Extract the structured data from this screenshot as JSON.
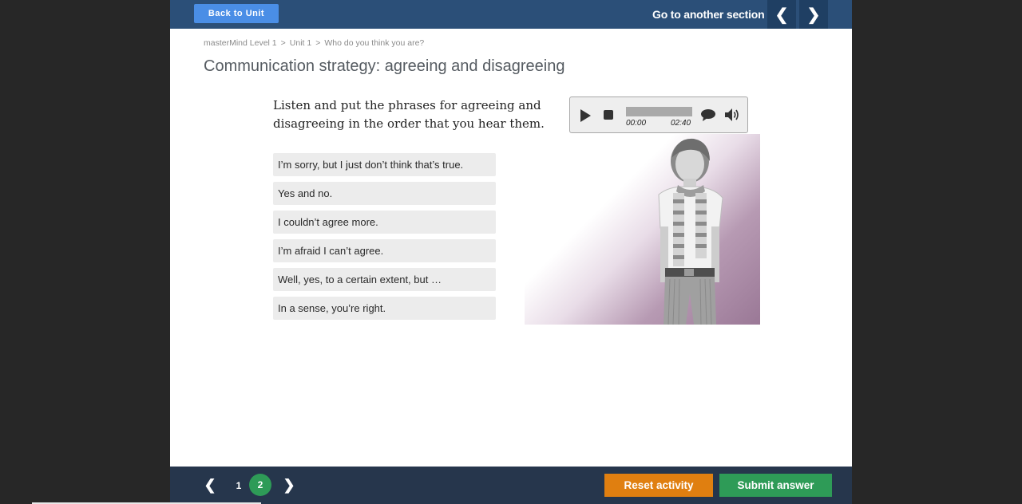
{
  "header": {
    "back_label": "Back to Unit",
    "goto_label": "Go to another section",
    "prev_icon": "chevron-left-icon",
    "next_icon": "chevron-right-icon"
  },
  "breadcrumb": {
    "items": [
      "masterMind Level 1",
      "Unit 1",
      "Who do you think you are?"
    ],
    "separator": ">"
  },
  "page_title": "Communication strategy: agreeing and disagreeing",
  "instructions": "Listen and put the phrases for agreeing and disagreeing in the order that you hear them.",
  "phrases": [
    "I’m sorry, but I just don’t think that’s true.",
    "Yes and no.",
    "I couldn’t agree more.",
    "I’m afraid I can’t agree.",
    "Well, yes, to a certain extent, but …",
    "In a sense, you’re right."
  ],
  "audio": {
    "current_time": "00:00",
    "total_time": "02:40",
    "progress": 0
  },
  "pagination": {
    "pages": [
      "1",
      "2"
    ],
    "current_page": "2"
  },
  "footer": {
    "reset_label": "Reset activity",
    "submit_label": "Submit answer"
  },
  "colors": {
    "header_bg": "#2b4f78",
    "back_button": "#4a8ee6",
    "footer_bg": "#26364c",
    "reset_button": "#e07f10",
    "submit_button": "#2e9b57",
    "active_page": "#2e9b57",
    "illustration_tint": "#9a7896"
  }
}
